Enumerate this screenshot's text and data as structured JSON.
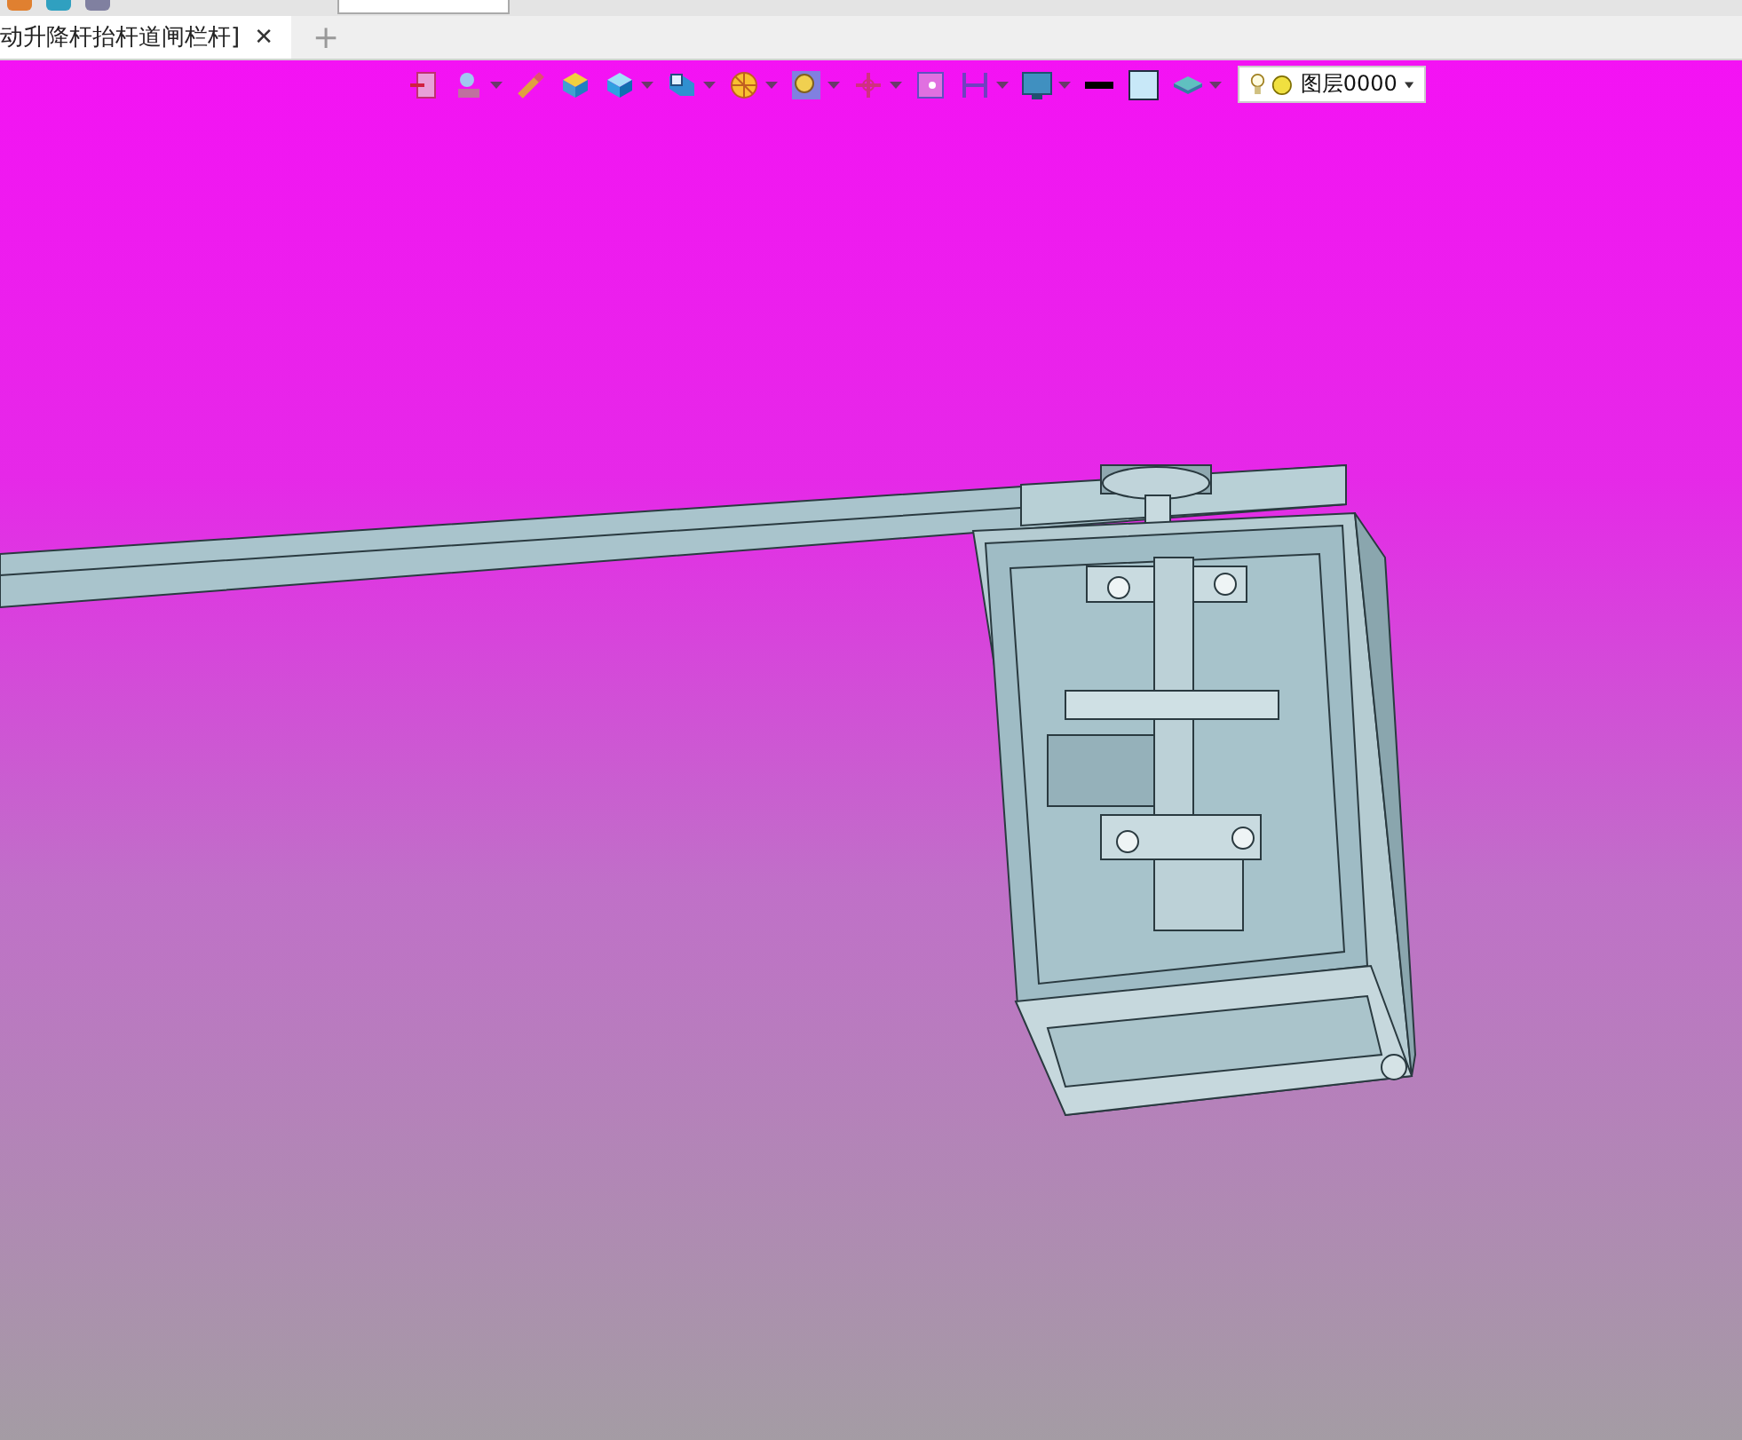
{
  "document_tabs": [
    {
      "title": "动升降杆抬杆道闸栏杆]",
      "close": "✕",
      "selected": true
    }
  ],
  "new_tab": "+",
  "layer_dropdown": {
    "value": "图层0000"
  }
}
